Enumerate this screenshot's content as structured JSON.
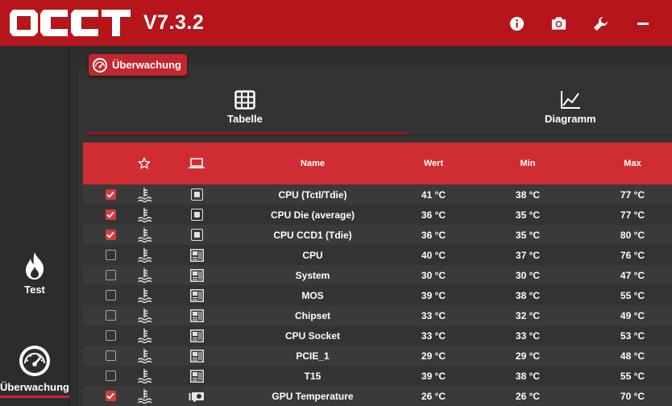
{
  "app": {
    "version": "V7.3.2",
    "accent": "#b5151b",
    "header_red": "#d02d33",
    "checkbox_red": "#d63a3f"
  },
  "titlebar": {
    "icons": [
      "info-icon",
      "camera-icon",
      "wrench-icon",
      "minimize-icon"
    ]
  },
  "sidebar": {
    "items": [
      {
        "label": "Test",
        "icon": "flame-icon",
        "active": false
      },
      {
        "label": "Überwachung",
        "icon": "gauge-icon",
        "active": true
      }
    ]
  },
  "panel": {
    "section_tab": "Überwachung",
    "view_tabs": [
      {
        "label": "Tabelle",
        "icon": "table-grid-icon",
        "active": true
      },
      {
        "label": "Diagramm",
        "icon": "line-chart-icon",
        "active": false
      }
    ]
  },
  "table": {
    "headers": {
      "favorite": "star-icon",
      "source": "laptop-icon",
      "name": "Name",
      "value": "Wert",
      "min": "Min",
      "max": "Max"
    },
    "rows": [
      {
        "checked": true,
        "source": "cpu",
        "name": "CPU (Tctl/Tdie)",
        "value": "41 °C",
        "min": "38 °C",
        "max": "77 °C"
      },
      {
        "checked": true,
        "source": "cpu",
        "name": "CPU Die (average)",
        "value": "36 °C",
        "min": "35 °C",
        "max": "77 °C"
      },
      {
        "checked": true,
        "source": "cpu",
        "name": "CPU CCD1 (Tdie)",
        "value": "36 °C",
        "min": "35 °C",
        "max": "80 °C"
      },
      {
        "checked": false,
        "source": "board",
        "name": "CPU",
        "value": "40 °C",
        "min": "37 °C",
        "max": "76 °C"
      },
      {
        "checked": false,
        "source": "board",
        "name": "System",
        "value": "30 °C",
        "min": "30 °C",
        "max": "47 °C"
      },
      {
        "checked": false,
        "source": "board",
        "name": "MOS",
        "value": "39 °C",
        "min": "38 °C",
        "max": "55 °C"
      },
      {
        "checked": false,
        "source": "board",
        "name": "Chipset",
        "value": "33 °C",
        "min": "32 °C",
        "max": "49 °C"
      },
      {
        "checked": false,
        "source": "board",
        "name": "CPU Socket",
        "value": "33 °C",
        "min": "33 °C",
        "max": "53 °C"
      },
      {
        "checked": false,
        "source": "board",
        "name": "PCIE_1",
        "value": "29 °C",
        "min": "29 °C",
        "max": "48 °C"
      },
      {
        "checked": false,
        "source": "board",
        "name": "T15",
        "value": "39 °C",
        "min": "38 °C",
        "max": "55 °C"
      },
      {
        "checked": true,
        "source": "gpu",
        "name": "GPU Temperature",
        "value": "26 °C",
        "min": "26 °C",
        "max": "70 °C"
      }
    ]
  }
}
